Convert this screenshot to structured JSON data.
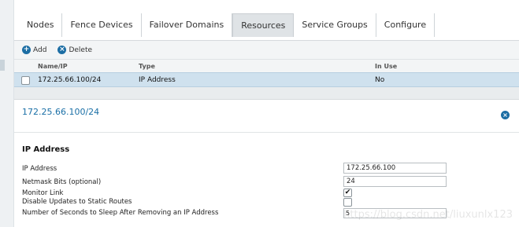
{
  "tabs": [
    "Nodes",
    "Fence Devices",
    "Failover Domains",
    "Resources",
    "Service Groups",
    "Configure"
  ],
  "active_tab": "Resources",
  "toolbar": {
    "add_label": "Add",
    "delete_label": "Delete"
  },
  "list": {
    "headers": {
      "name": "Name/IP",
      "type": "Type",
      "in_use": "In Use"
    },
    "rows": [
      {
        "name": "172.25.66.100/24",
        "type": "IP Address",
        "in_use": "No"
      }
    ]
  },
  "detail": {
    "title": "172.25.66.100/24",
    "section_title": "IP Address",
    "fields": {
      "ip_address": {
        "label": "IP Address",
        "value": "172.25.66.100"
      },
      "netmask": {
        "label": "Netmask Bits (optional)",
        "value": "24"
      },
      "monitor_link": {
        "label": "Monitor Link",
        "checked": true
      },
      "disable_updates": {
        "label": "Disable Updates to Static Routes",
        "checked": false
      },
      "sleep_seconds": {
        "label": "Number of Seconds to Sleep After Removing an IP Address",
        "value": "5"
      }
    }
  },
  "watermark": "https://blog.csdn.net/liuxunlx123",
  "colors": {
    "accent": "#1a6fa6",
    "selected_row": "#cfe1ee"
  }
}
